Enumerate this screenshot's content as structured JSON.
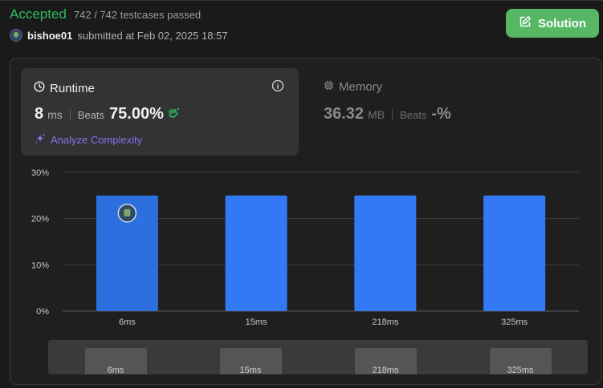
{
  "header": {
    "status": "Accepted",
    "testcases": "742 / 742 testcases passed",
    "username": "bishoe01",
    "submitted_meta": "submitted at Feb 02, 2025 18:57",
    "solution_label": "Solution"
  },
  "runtime": {
    "title": "Runtime",
    "value": "8",
    "unit": "ms",
    "beats_label": "Beats",
    "beats_value": "75.00%",
    "analyze_label": "Analyze Complexity"
  },
  "memory": {
    "title": "Memory",
    "value": "36.32",
    "unit": "MB",
    "beats_label": "Beats",
    "beats_value": "-%"
  },
  "colors": {
    "accepted": "#2cbb5d",
    "solution_button": "#56b764",
    "bar": "#3379f5",
    "bar_selected": "#2e6fe0",
    "analyze": "#8a6ff0"
  },
  "chart_data": {
    "type": "bar",
    "categories": [
      "6ms",
      "15ms",
      "218ms",
      "325ms"
    ],
    "values": [
      25,
      25,
      25,
      25
    ],
    "ylim": [
      0,
      30
    ],
    "yticks": [
      "0%",
      "10%",
      "20%",
      "30%"
    ],
    "yticks_values": [
      0,
      10,
      20,
      30
    ],
    "grid": true,
    "highlighted_category": "6ms"
  },
  "navigator": {
    "labels": [
      "6ms",
      "15ms",
      "218ms",
      "325ms"
    ]
  }
}
